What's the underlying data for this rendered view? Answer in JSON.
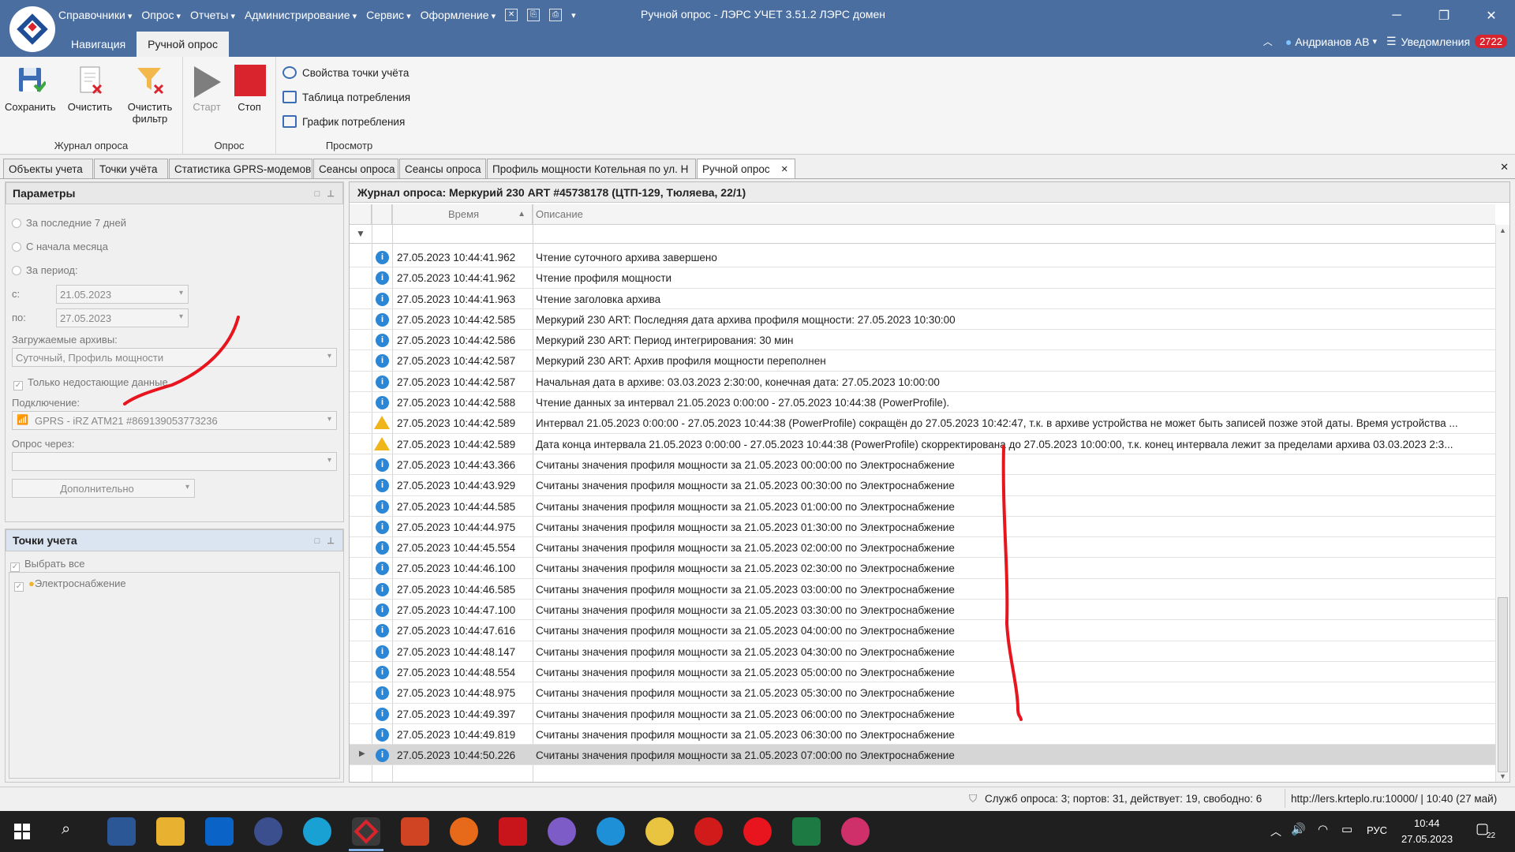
{
  "app": {
    "menu": [
      "Справочники",
      "Опрос",
      "Отчеты",
      "Администрирование",
      "Сервис",
      "Оформление"
    ],
    "title": "Ручной опрос - ЛЭРС УЧЕТ 3.51.2 ЛЭРС домен",
    "ribbon_tabs": [
      "Навигация",
      "Ручной опрос"
    ],
    "user": "Андрианов АВ",
    "notifications_label": "Уведомления",
    "notifications_count": "2722"
  },
  "ribbon": {
    "save": "Сохранить",
    "clear": "Очистить",
    "clear_filter_1": "Очистить",
    "clear_filter_2": "фильтр",
    "group_journal": "Журнал опроса",
    "start": "Старт",
    "stop": "Стоп",
    "group_poll": "Опрос",
    "props": "Свойства точки учёта",
    "table": "Таблица потребления",
    "chart": "График потребления",
    "group_view": "Просмотр"
  },
  "doc_tabs": [
    "Объекты учета",
    "Точки учёта",
    "Статистика GPRS-модемов",
    "Сеансы опроса",
    "Сеансы опроса",
    "Профиль мощности Котельная по ул. Н",
    "Ручной опрос"
  ],
  "params": {
    "title": "Параметры",
    "opt1": "За последние 7 дней",
    "opt2": "С начала месяца",
    "opt3": "За период:",
    "from_label": "с:",
    "from": "21.05.2023",
    "to_label": "по:",
    "to": "27.05.2023",
    "archives_label": "Загружаемые архивы:",
    "archives": "Суточный, Профиль мощности",
    "only_missing": "Только недостающие данные",
    "connection_label": "Подключение:",
    "connection": "GPRS - iRZ ATM21 #869139053773236",
    "via_label": "Опрос через:",
    "via": "",
    "more": "Дополнительно"
  },
  "points": {
    "title": "Точки учета",
    "select_all": "Выбрать все",
    "item": "Электроснабжение"
  },
  "journal": {
    "title": "Журнал опроса: Меркурий 230 ART #45738178 (ЦТП-129, Тюляева, 22/1)",
    "col_time": "Время",
    "col_desc": "Описание",
    "rows": [
      {
        "time": "27.05.2023 10:44:41.962",
        "desc": "Чтение суточного архива завершено",
        "type": "info"
      },
      {
        "time": "27.05.2023 10:44:41.962",
        "desc": "Чтение профиля мощности",
        "type": "info"
      },
      {
        "time": "27.05.2023 10:44:41.963",
        "desc": "Чтение заголовка архива",
        "type": "info"
      },
      {
        "time": "27.05.2023 10:44:42.585",
        "desc": "Меркурий 230 ART: Последняя дата архива профиля мощности: 27.05.2023 10:30:00",
        "type": "info"
      },
      {
        "time": "27.05.2023 10:44:42.586",
        "desc": "Меркурий 230 ART: Период интегрирования: 30 мин",
        "type": "info"
      },
      {
        "time": "27.05.2023 10:44:42.587",
        "desc": "Меркурий 230 ART: Архив профиля мощности переполнен",
        "type": "info"
      },
      {
        "time": "27.05.2023 10:44:42.587",
        "desc": "Начальная дата в архиве: 03.03.2023 2:30:00, конечная дата: 27.05.2023 10:00:00",
        "type": "info"
      },
      {
        "time": "27.05.2023 10:44:42.588",
        "desc": "Чтение данных за интервал 21.05.2023 0:00:00 - 27.05.2023 10:44:38 (PowerProfile).",
        "type": "info"
      },
      {
        "time": "27.05.2023 10:44:42.589",
        "desc": "Интервал 21.05.2023 0:00:00 - 27.05.2023 10:44:38 (PowerProfile) сокращён до 27.05.2023 10:42:47, т.к. в архиве устройства не может быть записей позже этой даты. Время устройства ...",
        "type": "warn"
      },
      {
        "time": "27.05.2023 10:44:42.589",
        "desc": "Дата конца интервала 21.05.2023 0:00:00 - 27.05.2023 10:44:38 (PowerProfile) скорректирована до 27.05.2023 10:00:00, т.к. конец интервала лежит за пределами архива 03.03.2023 2:3...",
        "type": "warn"
      },
      {
        "time": "27.05.2023 10:44:43.366",
        "desc": "Считаны значения профиля мощности за 21.05.2023 00:00:00 по Электроснабжение",
        "type": "info"
      },
      {
        "time": "27.05.2023 10:44:43.929",
        "desc": "Считаны значения профиля мощности за 21.05.2023 00:30:00 по Электроснабжение",
        "type": "info"
      },
      {
        "time": "27.05.2023 10:44:44.585",
        "desc": "Считаны значения профиля мощности за 21.05.2023 01:00:00 по Электроснабжение",
        "type": "info"
      },
      {
        "time": "27.05.2023 10:44:44.975",
        "desc": "Считаны значения профиля мощности за 21.05.2023 01:30:00 по Электроснабжение",
        "type": "info"
      },
      {
        "time": "27.05.2023 10:44:45.554",
        "desc": "Считаны значения профиля мощности за 21.05.2023 02:00:00 по Электроснабжение",
        "type": "info"
      },
      {
        "time": "27.05.2023 10:44:46.100",
        "desc": "Считаны значения профиля мощности за 21.05.2023 02:30:00 по Электроснабжение",
        "type": "info"
      },
      {
        "time": "27.05.2023 10:44:46.585",
        "desc": "Считаны значения профиля мощности за 21.05.2023 03:00:00 по Электроснабжение",
        "type": "info"
      },
      {
        "time": "27.05.2023 10:44:47.100",
        "desc": "Считаны значения профиля мощности за 21.05.2023 03:30:00 по Электроснабжение",
        "type": "info"
      },
      {
        "time": "27.05.2023 10:44:47.616",
        "desc": "Считаны значения профиля мощности за 21.05.2023 04:00:00 по Электроснабжение",
        "type": "info"
      },
      {
        "time": "27.05.2023 10:44:48.147",
        "desc": "Считаны значения профиля мощности за 21.05.2023 04:30:00 по Электроснабжение",
        "type": "info"
      },
      {
        "time": "27.05.2023 10:44:48.554",
        "desc": "Считаны значения профиля мощности за 21.05.2023 05:00:00 по Электроснабжение",
        "type": "info"
      },
      {
        "time": "27.05.2023 10:44:48.975",
        "desc": "Считаны значения профиля мощности за 21.05.2023 05:30:00 по Электроснабжение",
        "type": "info"
      },
      {
        "time": "27.05.2023 10:44:49.397",
        "desc": "Считаны значения профиля мощности за 21.05.2023 06:00:00 по Электроснабжение",
        "type": "info"
      },
      {
        "time": "27.05.2023 10:44:49.819",
        "desc": "Считаны значения профиля мощности за 21.05.2023 06:30:00 по Электроснабжение",
        "type": "info"
      },
      {
        "time": "27.05.2023 10:44:50.226",
        "desc": "Считаны значения профиля мощности за 21.05.2023 07:00:00 по Электроснабжение",
        "type": "info"
      }
    ]
  },
  "status": {
    "services": "Служб опроса: 3; портов: 31, действует: 19, свободно: 6",
    "server": "http://lers.krteplo.ru:10000/ | 10:40 (27 май)"
  },
  "taskbar": {
    "lang": "РУС",
    "time": "10:44",
    "date": "27.05.2023",
    "notif_count": "22"
  },
  "colors": {
    "titlebar": "#4a6ea0",
    "accent_red": "#d9232d",
    "info_icon": "#2c86d6",
    "warn_icon": "#f1b51c",
    "annotation": "#e8141e"
  }
}
